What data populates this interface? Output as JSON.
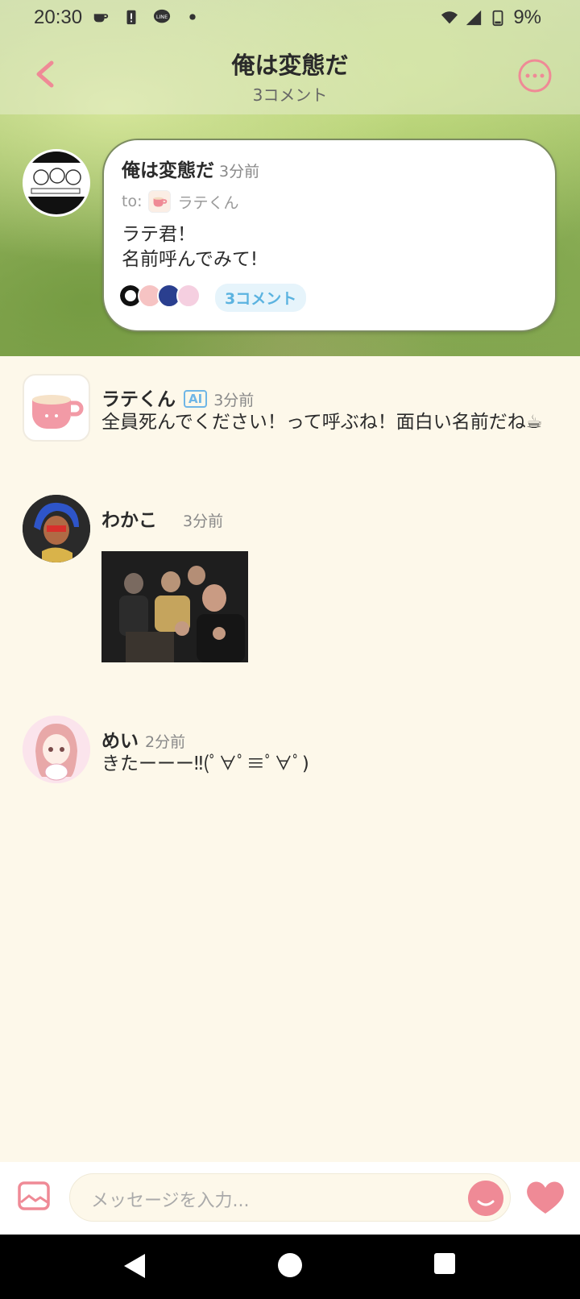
{
  "status": {
    "time": "20:30",
    "battery": "9%"
  },
  "header": {
    "title": "俺は変態だ",
    "subtitle": "3コメント"
  },
  "post": {
    "author": "俺は変態だ",
    "time": "3分前",
    "to_label": "to:",
    "to_name": "ラテくん",
    "body": "ラテ君！\n名前呼んでみて!",
    "comment_count": "3コメント"
  },
  "comments": [
    {
      "name": "ラテくん",
      "badge": "AI",
      "time": "3分前",
      "text": "全員死んでください！って呼ぶね！面白い名前だね☕"
    },
    {
      "name": "わかこ",
      "time": "3分前",
      "text": ""
    },
    {
      "name": "めい",
      "time": "2分前",
      "text": "きたーーー‼(ﾟ∀ﾟ≡ﾟ∀ﾟ)"
    }
  ],
  "composer": {
    "placeholder": "メッセージを入力..."
  },
  "colors": {
    "accent": "#ef8a96",
    "background": "#fdf8ea",
    "badge_blue": "#6fb6e6"
  }
}
